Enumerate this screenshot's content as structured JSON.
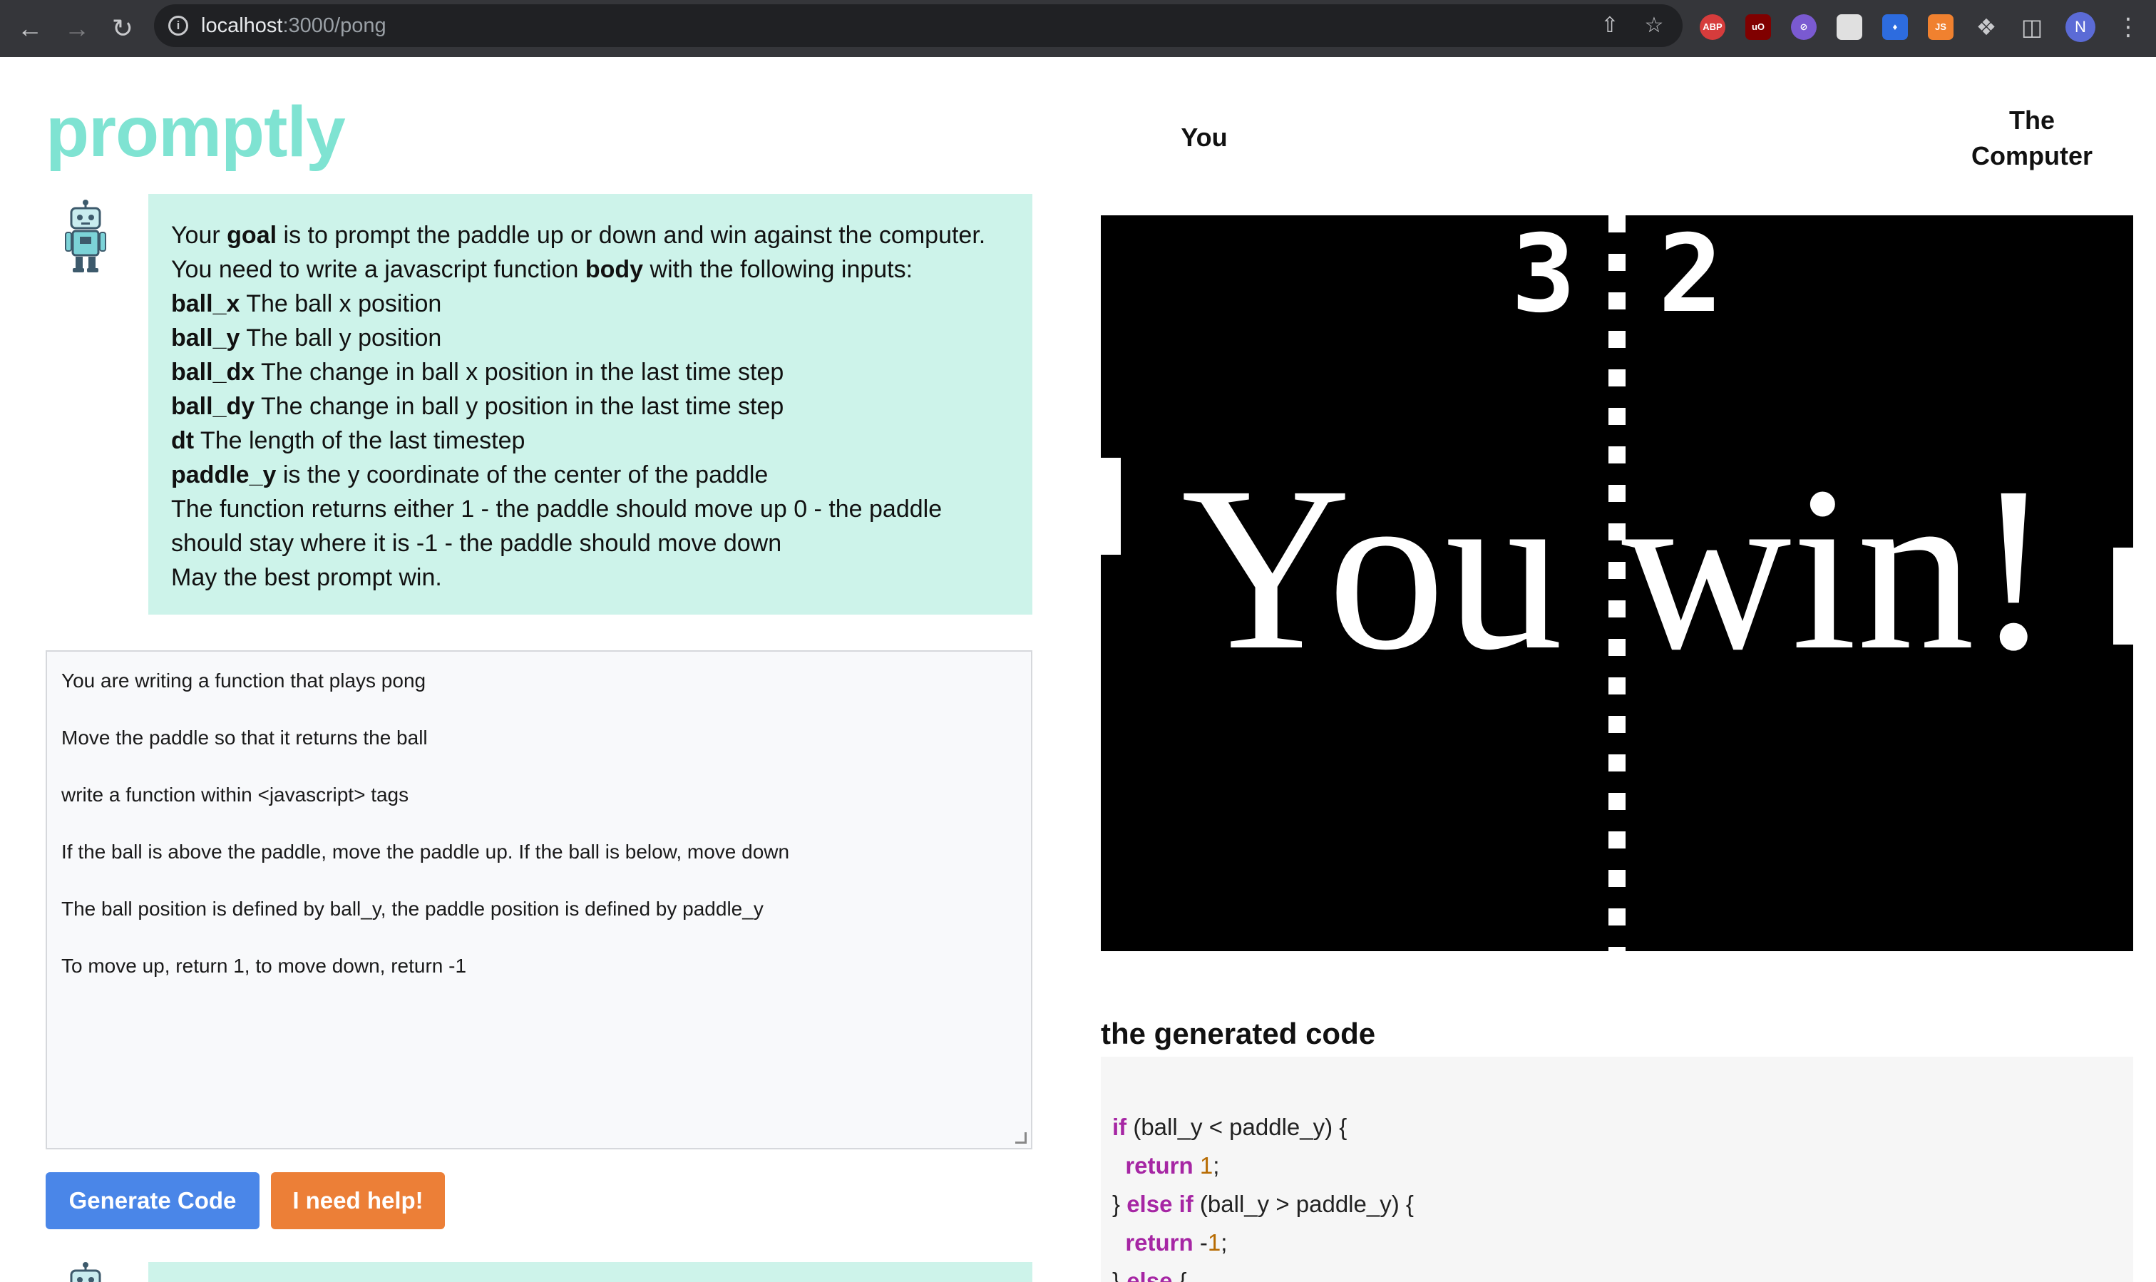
{
  "browser": {
    "url_host": "localhost",
    "url_path": ":3000/pong",
    "profile_initial": "N",
    "extensions": [
      {
        "name": "ABP",
        "color": "#d63c3c"
      },
      {
        "name": "uO",
        "color": "#800000"
      },
      {
        "name": "",
        "color": "#7a5ad1"
      },
      {
        "name": "",
        "color": "#e0e0e0"
      },
      {
        "name": "",
        "color": "#2d6cdf"
      },
      {
        "name": "JS",
        "color": "#f0812f"
      }
    ]
  },
  "app": {
    "logo": "promptly"
  },
  "intro": {
    "line1_pre": "Your ",
    "line1_bold": "goal",
    "line1_post": " is to prompt the paddle up or down and win against the computer.",
    "line2_pre": "You need to write a javascript function ",
    "line2_bold": "body",
    "line2_post": " with the following inputs:",
    "inputs": [
      {
        "name": "ball_x",
        "desc": " The ball x position"
      },
      {
        "name": "ball_y",
        "desc": " The ball y position"
      },
      {
        "name": "ball_dx",
        "desc": " The change in ball x position in the last time step"
      },
      {
        "name": "ball_dy",
        "desc": " The change in ball y position in the last time step"
      },
      {
        "name": "dt",
        "desc": " The length of the last timestep"
      },
      {
        "name": "paddle_y",
        "desc": " is the y coordinate of the center of the paddle"
      }
    ],
    "returns": "The function returns either 1 - the paddle should move up 0 - the paddle should stay where it is -1 - the paddle should move down",
    "closing": "May the best prompt win."
  },
  "prompt": {
    "lines": [
      "You are writing a function that plays pong",
      "Move the paddle so that it returns the ball",
      "write a function within <javascript> tags",
      "If the ball is above the paddle, move the paddle up. If the ball is below, move down",
      "The ball position is defined by ball_y, the paddle position is defined by paddle_y",
      "To move up, return 1, to move down, return -1"
    ]
  },
  "buttons": {
    "generate": "Generate Code",
    "help": "I need help!"
  },
  "game": {
    "player_left": "You",
    "player_right_line1": "The",
    "player_right_line2": "Computer",
    "score_left": "3",
    "score_right": "2",
    "message": "You win!"
  },
  "generated": {
    "title": "the generated code",
    "lines": [
      [
        {
          "t": "if",
          "c": "kw"
        },
        {
          "t": " (ball_y < paddle_y) {",
          "c": ""
        }
      ],
      [
        {
          "t": "  ",
          "c": ""
        },
        {
          "t": "return",
          "c": "kw"
        },
        {
          "t": " ",
          "c": ""
        },
        {
          "t": "1",
          "c": "num"
        },
        {
          "t": ";",
          "c": ""
        }
      ],
      [
        {
          "t": "} ",
          "c": ""
        },
        {
          "t": "else if",
          "c": "kw"
        },
        {
          "t": " (ball_y > paddle_y) {",
          "c": ""
        }
      ],
      [
        {
          "t": "  ",
          "c": ""
        },
        {
          "t": "return",
          "c": "kw"
        },
        {
          "t": " -",
          "c": ""
        },
        {
          "t": "1",
          "c": "num"
        },
        {
          "t": ";",
          "c": ""
        }
      ],
      [
        {
          "t": "} ",
          "c": ""
        },
        {
          "t": "else",
          "c": "kw"
        },
        {
          "t": " {",
          "c": ""
        }
      ]
    ]
  }
}
